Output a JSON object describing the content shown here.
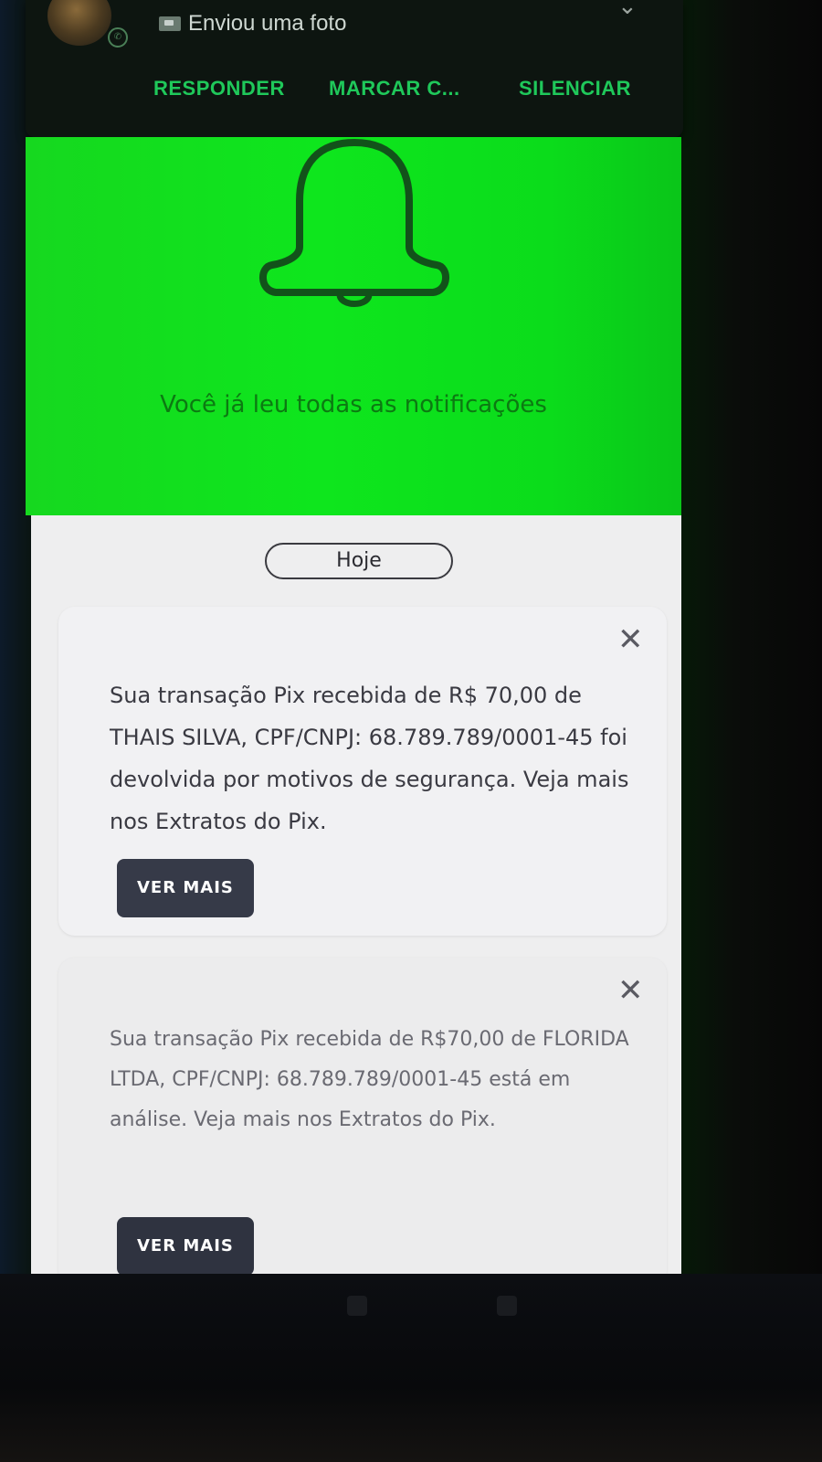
{
  "notification": {
    "text": "Enviou uma foto",
    "app_icon": "whatsapp-icon",
    "actions": {
      "reply": "RESPONDER",
      "mark": "MARCAR C...",
      "mute": "SILENCIAR"
    }
  },
  "header": {
    "icon": "bell-icon",
    "empty_message": "Você já leu todas as notificações",
    "background_color": "#0ee61d"
  },
  "date_group": "Hoje",
  "cards": [
    {
      "message": "Sua transação Pix recebida de R$ 70,00 de THAIS SILVA, CPF/CNPJ: 68.789.789/0001-45 foi devolvida por motivos de segurança. Veja mais nos Extratos do Pix.",
      "button": "VER MAIS"
    },
    {
      "message": "Sua transação Pix recebida de R$70,00 de FLORIDA LTDA, CPF/CNPJ: 68.789.789/0001-45 está em análise. Veja mais nos Extratos do Pix.",
      "button": "VER MAIS"
    }
  ],
  "colors": {
    "accent_green": "#1fc85a",
    "button_dark": "#363a48"
  }
}
